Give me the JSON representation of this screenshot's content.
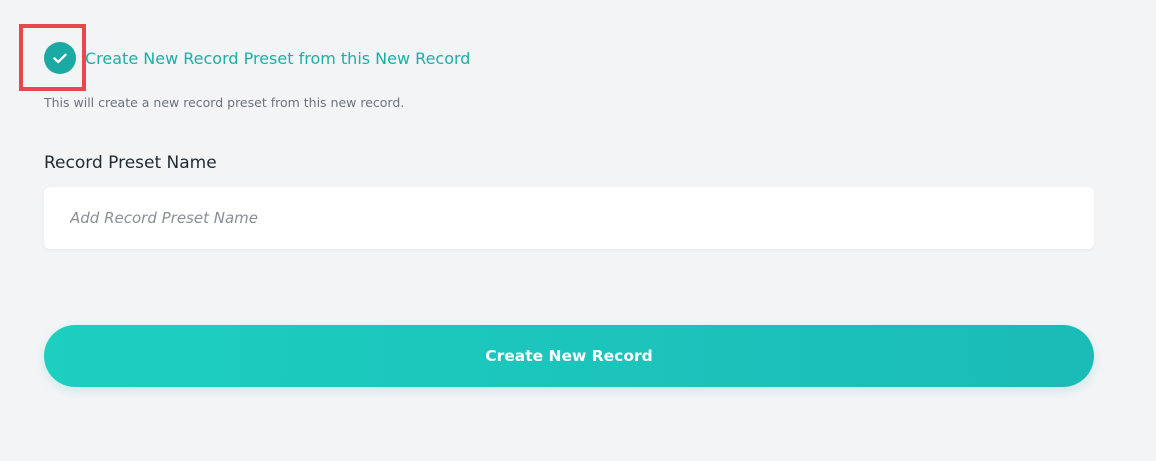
{
  "preset_option": {
    "checked": true,
    "label": "Create New Record Preset from this New Record",
    "help_text": "This will create a new record preset from this new record.",
    "check_icon": "checkmark-icon"
  },
  "preset_name": {
    "label": "Record Preset Name",
    "placeholder": "Add Record Preset Name",
    "value": ""
  },
  "actions": {
    "submit_label": "Create New Record"
  },
  "colors": {
    "accent": "#1aa9a3",
    "highlight": "#e8484d"
  }
}
